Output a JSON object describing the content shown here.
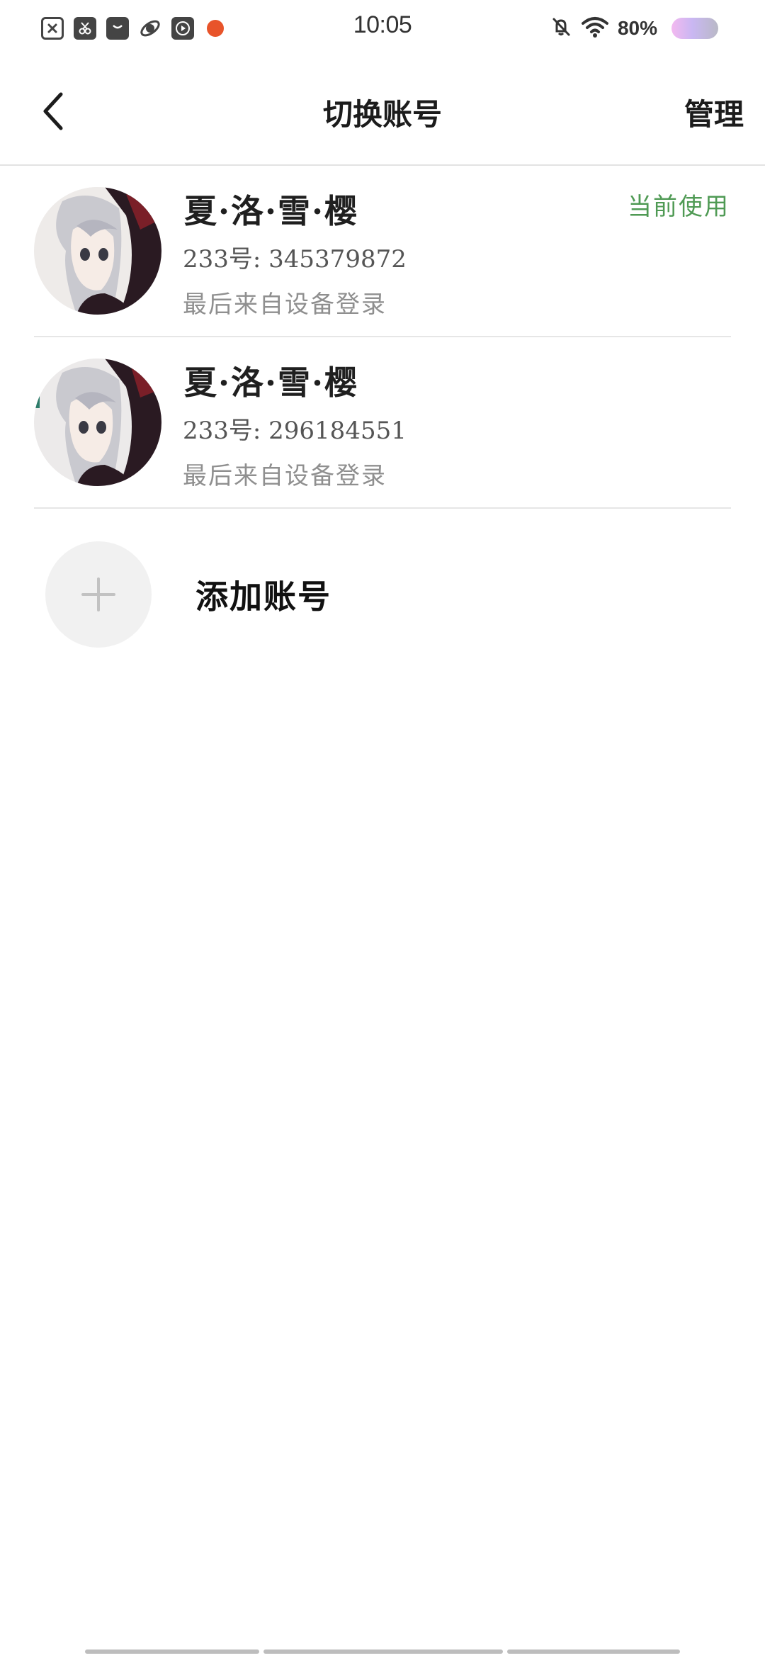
{
  "status_bar": {
    "time": "10:05",
    "battery": "80%",
    "left_icons": [
      "document-x-icon",
      "scissors-icon",
      "bag-icon",
      "planet-icon",
      "play-icon",
      "orange-dot-icon"
    ],
    "right_icons": [
      "bell-off-icon",
      "wifi-icon",
      "battery-icon"
    ]
  },
  "header": {
    "title": "切换账号",
    "manage_label": "管理"
  },
  "accounts": [
    {
      "name": "夏·洛·雪·樱",
      "id_line": "233号: 345379872",
      "source": "最后来自设备登录",
      "badge": "当前使用"
    },
    {
      "name": "夏·洛·雪·樱",
      "id_line": "233号: 296184551",
      "source": "最后来自设备登录"
    }
  ],
  "add_account": {
    "label": "添加账号"
  },
  "colors": {
    "accent_green": "#4f9a54",
    "divider": "#e6e6e6",
    "muted_text": "#8f8f8f"
  }
}
